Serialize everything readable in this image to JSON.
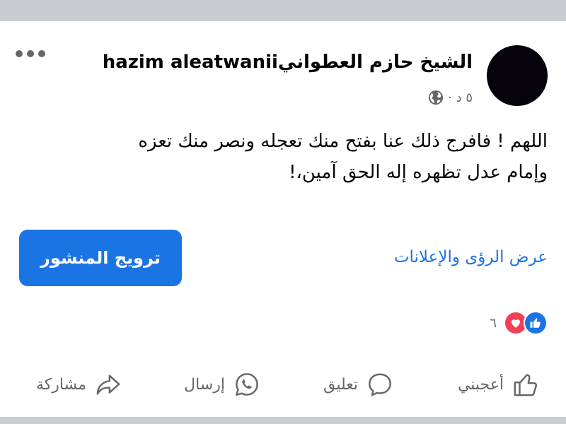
{
  "post": {
    "author_name": "الشيخ حازم العطوانيhazim aleatwanii",
    "time": "٥ د ·",
    "text_line1": "اللهم ! فافرج ذلك عنا بفتح منك تعجله ونصر منك تعزه",
    "text_line2": "وإمام عدل تظهره إله الحق آمين،!",
    "privacy_icon": "globe-icon",
    "more_icon": "more-options-icon"
  },
  "promo": {
    "insights_link": "عرض الرؤى والإعلانات",
    "boost_button": "ترويج المنشور"
  },
  "reactions": {
    "count": "٦",
    "types": [
      "like",
      "love"
    ]
  },
  "actions": {
    "like": "أعجبني",
    "comment": "تعليق",
    "send": "إرسال",
    "share": "مشاركة"
  },
  "colors": {
    "accent": "#1b74e4",
    "love": "#f33e58",
    "muted_text": "#65676b",
    "separator": "#c9ccd1"
  }
}
